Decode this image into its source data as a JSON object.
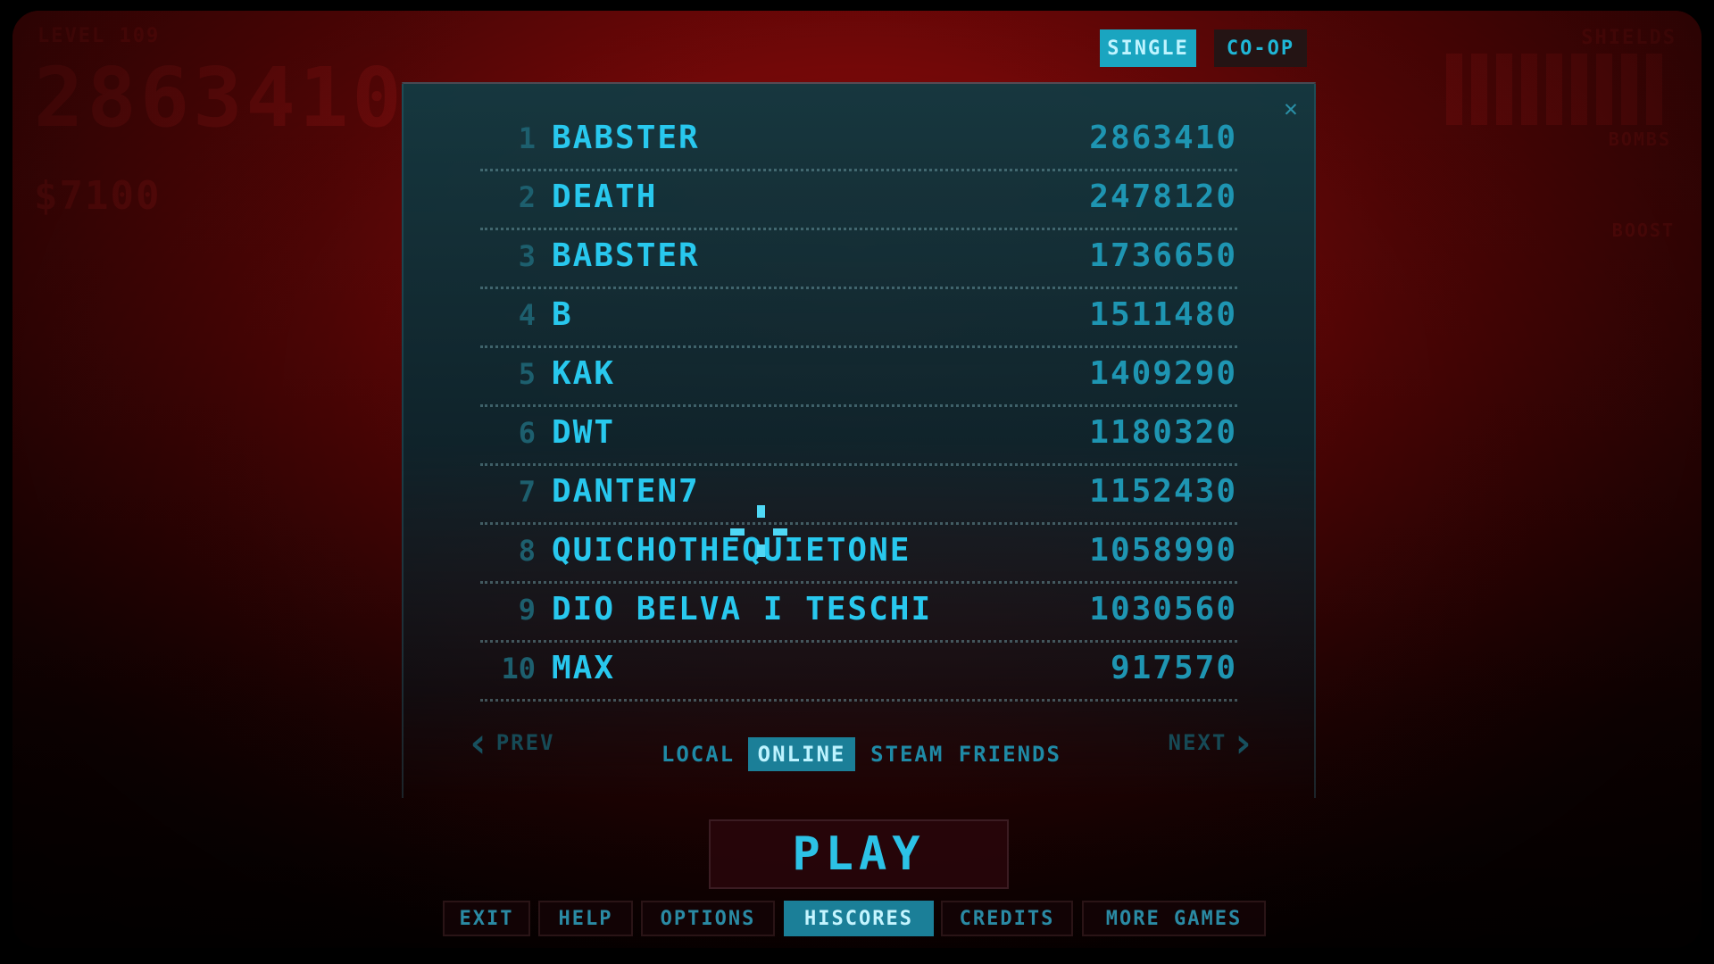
{
  "hud": {
    "level_label": "LEVEL 109",
    "score": "2863410",
    "money": "$7100",
    "shields_label": "SHIELDS",
    "bombs_label": "BOMBS",
    "boost_label": "BOOST"
  },
  "mode": {
    "single_label": "SINGLE",
    "coop_label": "CO-OP",
    "selected": "SINGLE"
  },
  "hiscores": [
    {
      "rank": "1",
      "name": "BABSTER",
      "score": "2863410"
    },
    {
      "rank": "2",
      "name": "DEATH",
      "score": "2478120"
    },
    {
      "rank": "3",
      "name": "BABSTER",
      "score": "1736650"
    },
    {
      "rank": "4",
      "name": "B",
      "score": "1511480"
    },
    {
      "rank": "5",
      "name": "KAK",
      "score": "1409290"
    },
    {
      "rank": "6",
      "name": "DWT",
      "score": "1180320"
    },
    {
      "rank": "7",
      "name": "DANTEN7",
      "score": "1152430"
    },
    {
      "rank": "8",
      "name": "QUICHOTHEQUIETONE",
      "score": "1058990"
    },
    {
      "rank": "9",
      "name": "DIO BELVA I TESCHI",
      "score": "1030560"
    },
    {
      "rank": "10",
      "name": "MAX",
      "score": "917570"
    }
  ],
  "nav": {
    "prev_label": "PREV",
    "next_label": "NEXT"
  },
  "tabs": {
    "local_label": "LOCAL",
    "online_label": "ONLINE",
    "steam_label": "STEAM FRIENDS",
    "selected": "ONLINE"
  },
  "play_label": "PLAY",
  "menu": {
    "exit": "EXIT",
    "help": "HELP",
    "options": "OPTIONS",
    "hiscores": "HISCORES",
    "credits": "CREDITS",
    "more_games": "MORE GAMES",
    "active": "HISCORES"
  },
  "colors": {
    "accent_cyan": "#28c8ee",
    "active_tab": "#1b7f98",
    "background_red": "#6a0707"
  }
}
